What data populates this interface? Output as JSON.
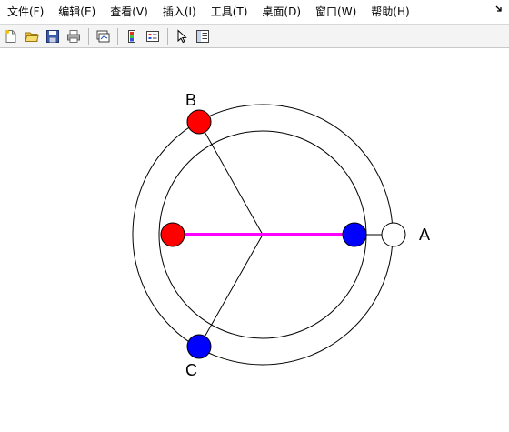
{
  "menu": {
    "items": [
      {
        "key": "file",
        "label": "文件(F)"
      },
      {
        "key": "edit",
        "label": "编辑(E)"
      },
      {
        "key": "view",
        "label": "查看(V)"
      },
      {
        "key": "insert",
        "label": "插入(I)"
      },
      {
        "key": "tools",
        "label": "工具(T)"
      },
      {
        "key": "desktop",
        "label": "桌面(D)"
      },
      {
        "key": "window",
        "label": "窗口(W)"
      },
      {
        "key": "help",
        "label": "帮助(H)"
      }
    ],
    "overflow_icon": "dock-arrow-icon"
  },
  "toolbar": {
    "buttons": [
      {
        "key": "new",
        "icon": "new-file-icon"
      },
      {
        "key": "open",
        "icon": "open-folder-icon"
      },
      {
        "key": "save",
        "icon": "save-disk-icon"
      },
      {
        "key": "print",
        "icon": "print-icon"
      },
      {
        "key": "link-plot",
        "icon": "link-plot-icon"
      },
      {
        "key": "colorbar",
        "icon": "colorbar-icon"
      },
      {
        "key": "legend",
        "icon": "legend-icon"
      },
      {
        "key": "select",
        "icon": "pointer-arrow-icon"
      },
      {
        "key": "property-editor",
        "icon": "property-editor-icon"
      }
    ]
  },
  "figure": {
    "labels": {
      "a": "A",
      "b": "B",
      "c": "C"
    },
    "colors": {
      "red": "#ff0000",
      "blue": "#0000ff",
      "magenta": "#ff00ff",
      "white": "#ffffff",
      "line": "#000000"
    }
  }
}
